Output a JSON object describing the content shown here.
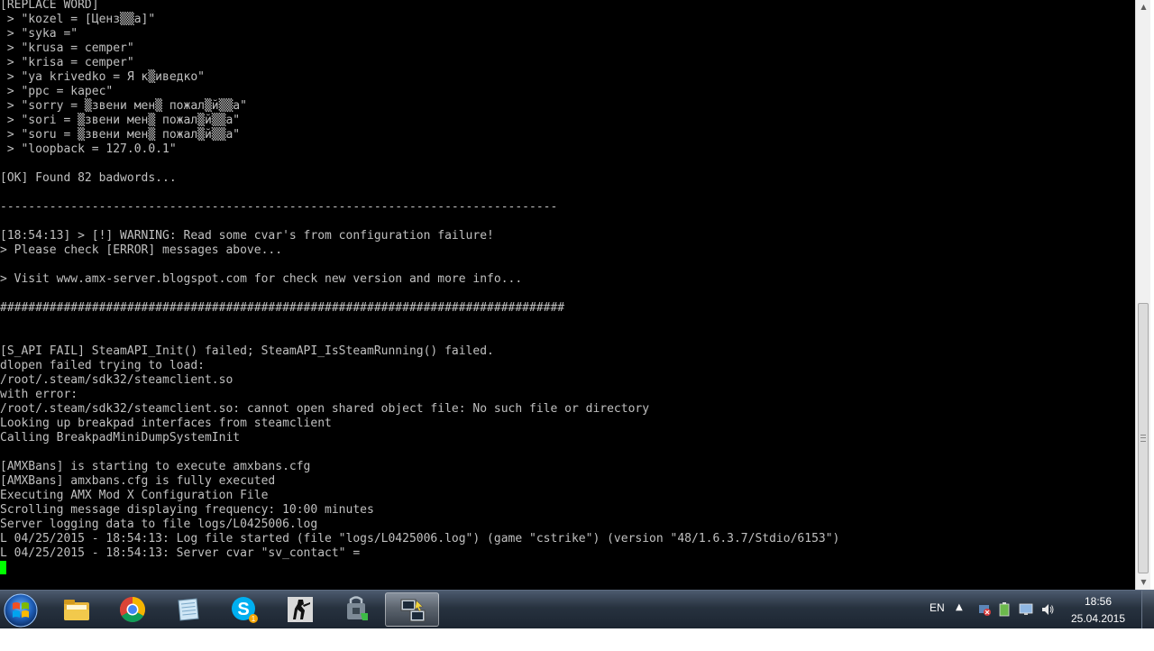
{
  "terminal": {
    "lines": [
      "[REPLACE WORD]",
      " > \"kozel = [Ценз▒▒а]\"",
      " > \"syka =\"",
      " > \"krusa = cemper\"",
      " > \"krisa = cemper\"",
      " > \"ya krivedko = Я к▒иведко\"",
      " > \"ppc = kapec\"",
      " > \"sorry = ▒звени мен▒ пожал▒й▒▒а\"",
      " > \"sori = ▒звени мен▒ пожал▒й▒▒а\"",
      " > \"soru = ▒звени мен▒ пожал▒й▒▒а\"",
      " > \"loopback = 127.0.0.1\"",
      "",
      "[OK] Found 82 badwords...",
      "",
      "-------------------------------------------------------------------------------",
      "",
      "[18:54:13] > [!] WARNING: Read some cvar's from configuration failure!",
      "> Please check [ERROR] messages above...",
      "",
      "> Visit www.amx-server.blogspot.com for check new version and more info...",
      "",
      "################################################################################",
      "",
      "",
      "[S_API FAIL] SteamAPI_Init() failed; SteamAPI_IsSteamRunning() failed.",
      "dlopen failed trying to load:",
      "/root/.steam/sdk32/steamclient.so",
      "with error:",
      "/root/.steam/sdk32/steamclient.so: cannot open shared object file: No such file or directory",
      "Looking up breakpad interfaces from steamclient",
      "Calling BreakpadMiniDumpSystemInit",
      "",
      "[AMXBans] is starting to execute amxbans.cfg",
      "[AMXBans] amxbans.cfg is fully executed",
      "Executing AMX Mod X Configuration File",
      "Scrolling message displaying frequency: 10:00 minutes",
      "Server logging data to file logs/L0425006.log",
      "L 04/25/2015 - 18:54:13: Log file started (file \"logs/L0425006.log\") (game \"cstrike\") (version \"48/1.6.3.7/Stdio/6153\")",
      "L 04/25/2015 - 18:54:13: Server cvar \"sv_contact\" = "
    ],
    "text_color": "#c0c0c0",
    "cursor_color": "#00ff00"
  },
  "taskbar": {
    "language": "EN",
    "time": "18:56",
    "date": "25.04.2015",
    "buttons": [
      {
        "icon": "windows-start-icon"
      },
      {
        "icon": "folder-icon"
      },
      {
        "icon": "chrome-icon"
      },
      {
        "icon": "notepad-icon"
      },
      {
        "icon": "skype-icon",
        "badge": "1"
      },
      {
        "icon": "counter-strike-icon"
      },
      {
        "icon": "server-lock-icon"
      },
      {
        "icon": "putty-icon"
      }
    ],
    "skype_badge": "1"
  }
}
